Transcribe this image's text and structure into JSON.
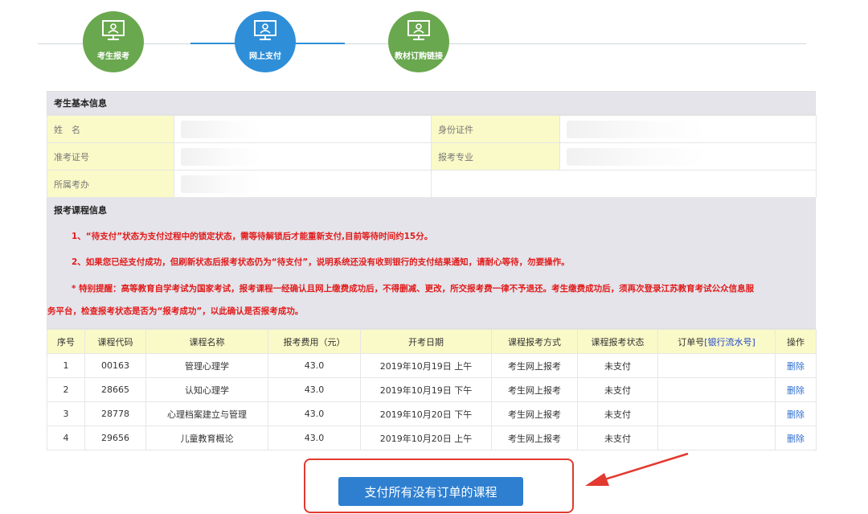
{
  "steps": [
    {
      "label": "考生报考",
      "icon": "monitor-user-icon",
      "color": "#6aa84f"
    },
    {
      "label": "网上支付",
      "icon": "monitor-user-icon",
      "color": "#2e8fd8"
    },
    {
      "label": "教材订购链接",
      "icon": "monitor-user-icon",
      "color": "#6aa84f"
    }
  ],
  "basic": {
    "title": "考生基本信息",
    "name_label": "姓　名",
    "id_label": "身份证件",
    "ticket_label": "准考证号",
    "major_label": "报考专业",
    "office_label": "所属考办"
  },
  "courses_section": {
    "title": "报考课程信息",
    "notice1": "1、“待支付”状态为支付过程中的锁定状态，需等待解锁后才能重新支付,目前等待时间约15分。",
    "notice2": "2、如果您已经支付成功，但刷新状态后报考状态仍为“待支付”，说明系统还没有收到银行的支付结果通知，请耐心等待，勿要操作。",
    "notice3a": "* 特别提醒：高等教育自学考试为国家考试，报考课程一经确认且网上缴费成功后，不得删减、更改，所交报考费一律不予退还。考生缴费成功后，须再次登录江苏教育考试公众信息服",
    "notice3b": "务平台，检查报考状态是否为“报考成功”，以此确认是否报考成功。"
  },
  "table": {
    "headers": {
      "no": "序号",
      "code": "课程代码",
      "name": "课程名称",
      "fee": "报考费用（元）",
      "date": "开考日期",
      "method": "课程报考方式",
      "status": "课程报考状态",
      "order": "订单号",
      "order_link": "[银行流水号]",
      "op": "操作"
    },
    "rows": [
      {
        "no": "1",
        "code": "00163",
        "name": "管理心理学",
        "fee": "43.0",
        "date": "2019年10月19日 上午",
        "method": "考生网上报考",
        "status": "未支付",
        "order": "",
        "op": "删除"
      },
      {
        "no": "2",
        "code": "28665",
        "name": "认知心理学",
        "fee": "43.0",
        "date": "2019年10月19日 下午",
        "method": "考生网上报考",
        "status": "未支付",
        "order": "",
        "op": "删除"
      },
      {
        "no": "3",
        "code": "28778",
        "name": "心理档案建立与管理",
        "fee": "43.0",
        "date": "2019年10月20日 下午",
        "method": "考生网上报考",
        "status": "未支付",
        "order": "",
        "op": "删除"
      },
      {
        "no": "4",
        "code": "29656",
        "name": "儿童教育概论",
        "fee": "43.0",
        "date": "2019年10月20日 上午",
        "method": "考生网上报考",
        "status": "未支付",
        "order": "",
        "op": "删除"
      }
    ]
  },
  "pay_button": "支付所有没有订单的课程",
  "colors": {
    "accent": "#2e7fd0",
    "alert": "#e11b1b",
    "highlight": "#e23a30"
  }
}
